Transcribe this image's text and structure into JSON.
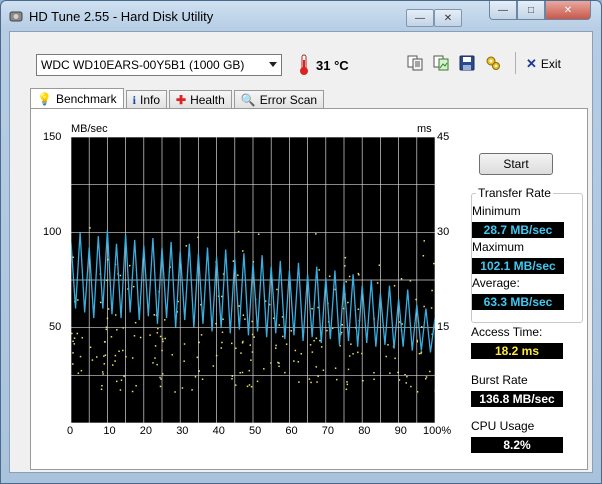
{
  "window": {
    "title": "HD Tune 2.55 - Hard Disk Utility",
    "controls": {
      "minimize": "—",
      "maximize": "□",
      "close": "✕"
    }
  },
  "toolbar": {
    "drive": "WDC WD10EARS-00Y5B1 (1000 GB)",
    "temperature": "31 °C",
    "exit_label": "Exit",
    "icons": [
      "copy-text-icon",
      "copy-image-icon",
      "save-icon",
      "options-icon"
    ]
  },
  "tabs": [
    {
      "label": "Benchmark",
      "icon": "lightbulb-icon",
      "active": true
    },
    {
      "label": "Info",
      "icon": "info-icon",
      "active": false
    },
    {
      "label": "Health",
      "icon": "health-cross-icon",
      "active": false
    },
    {
      "label": "Error Scan",
      "icon": "magnifier-icon",
      "active": false
    }
  ],
  "benchmark": {
    "start_label": "Start",
    "transfer_rate": {
      "title": "Transfer Rate",
      "minimum_label": "Minimum",
      "minimum": "28.7 MB/sec",
      "maximum_label": "Maximum",
      "maximum": "102.1 MB/sec",
      "average_label": "Average:",
      "average": "63.3 MB/sec"
    },
    "access_time_label": "Access Time:",
    "access_time": "18.2 ms",
    "burst_rate_label": "Burst Rate",
    "burst_rate": "136.8 MB/sec",
    "cpu_usage_label": "CPU Usage",
    "cpu_usage": "8.2%"
  },
  "chart_data": {
    "type": "line",
    "left_axis_unit": "MB/sec",
    "right_axis_unit": "ms",
    "left_ticks": [
      "150",
      "100",
      "50"
    ],
    "right_ticks": [
      "45",
      "30",
      "15"
    ],
    "x_ticks": [
      "0",
      "10",
      "20",
      "30",
      "40",
      "50",
      "60",
      "70",
      "80",
      "90",
      "100%"
    ],
    "ylim": [
      0,
      150
    ],
    "y2lim": [
      0,
      45
    ],
    "xlim": [
      0,
      100
    ],
    "grid": true,
    "series": [
      {
        "color": "#3aaee0",
        "x": [
          0,
          2.5,
          5,
          7.5,
          10,
          12.5,
          15,
          17.5,
          20,
          22.5,
          25,
          27.5,
          30,
          32.5,
          35,
          37.5,
          40,
          42.5,
          45,
          47.5,
          50,
          52.5,
          55,
          57.5,
          60,
          62.5,
          65,
          67.5,
          70,
          72.5,
          75,
          77.5,
          80,
          82.5,
          85,
          87.5,
          90,
          92.5,
          95,
          97.5,
          100
        ],
        "values": [
          95,
          100,
          92,
          98,
          101,
          94,
          99,
          96,
          93,
          97,
          92,
          95,
          90,
          94,
          89,
          92,
          87,
          91,
          86,
          89,
          84,
          88,
          82,
          85,
          80,
          84,
          78,
          82,
          76,
          80,
          74,
          78,
          72,
          75,
          68,
          72,
          65,
          70,
          62,
          60,
          55
        ],
        "low_values": [
          60,
          58,
          55,
          60,
          57,
          55,
          58,
          54,
          56,
          52,
          55,
          50,
          54,
          50,
          52,
          48,
          50,
          47,
          49,
          46,
          48,
          45,
          47,
          44,
          46,
          43,
          45,
          42,
          44,
          41,
          43,
          40,
          42,
          40,
          41,
          39,
          40,
          38,
          38,
          37,
          36
        ]
      },
      {
        "color": "#e8e06a",
        "kind": "access-time-scatter",
        "range_ms": [
          5,
          33
        ]
      }
    ]
  }
}
